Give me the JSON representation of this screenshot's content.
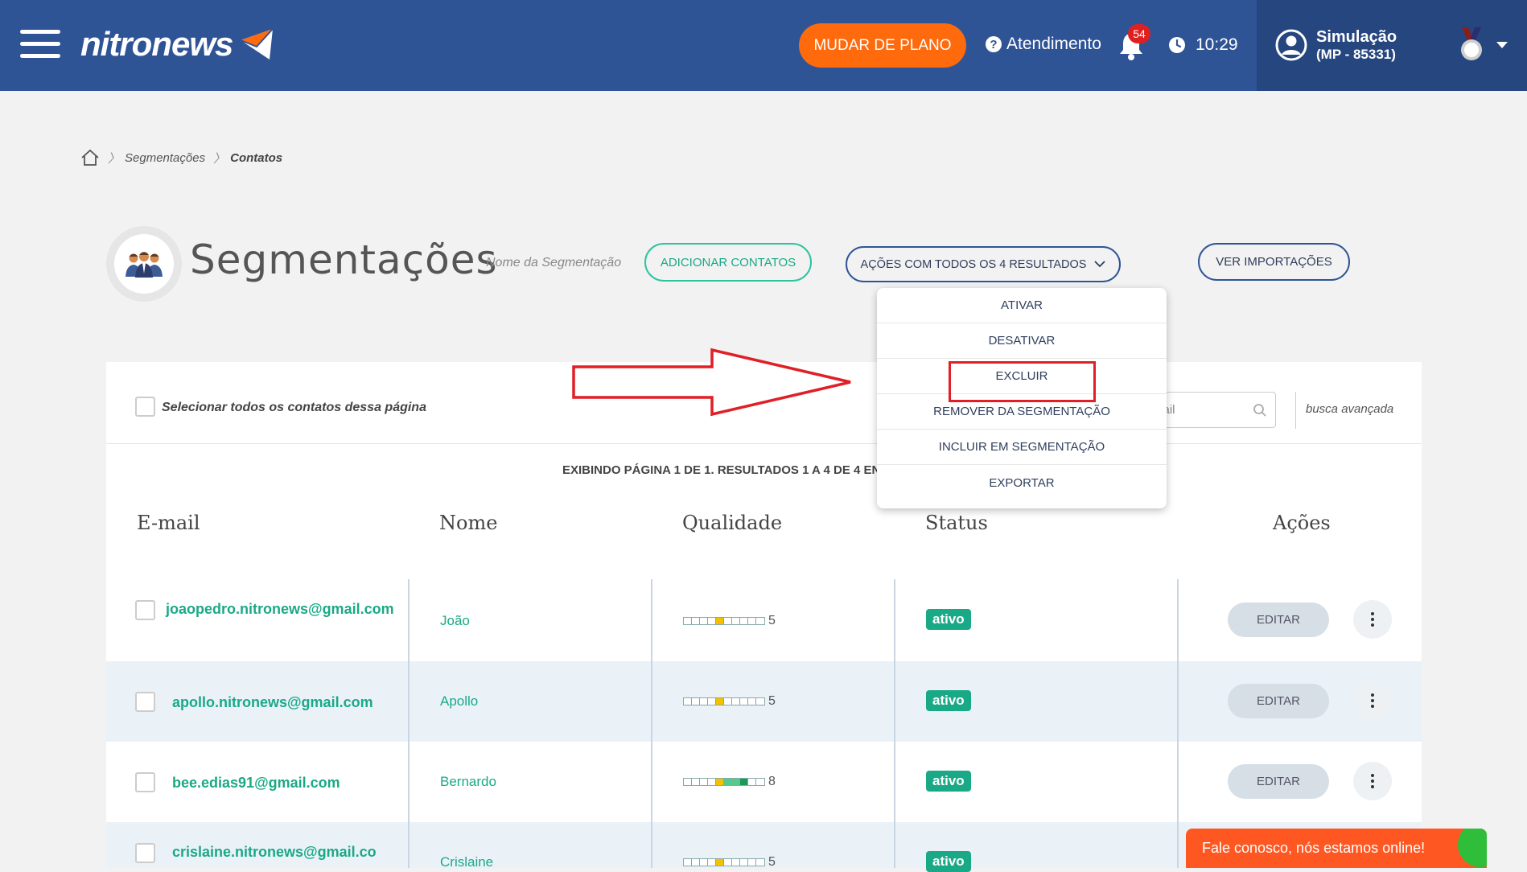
{
  "header": {
    "logo_text": "nitronews",
    "plan_button": "MUDAR DE PLANO",
    "support_label": "Atendimento",
    "notifications_count": "54",
    "time": "10:29",
    "user_name": "Simulação",
    "user_account": "(MP - 85331)"
  },
  "breadcrumb": {
    "items": [
      "Segmentações",
      "Contatos"
    ]
  },
  "page": {
    "title": "Segmentações",
    "segment_name_placeholder": "Nome da Segmentação",
    "add_contacts": "ADICIONAR CONTATOS",
    "bulk_actions": "AÇÕES COM TODOS OS 4 RESULTADOS",
    "view_imports": "VER IMPORTAÇÕES"
  },
  "dropdown": {
    "items": [
      "ATIVAR",
      "DESATIVAR",
      "EXCLUIR",
      "REMOVER DA SEGMENTAÇÃO",
      "INCLUIR EM SEGMENTAÇÃO",
      "EXPORTAR"
    ],
    "highlighted": "EXCLUIR"
  },
  "table": {
    "select_all_label": "Selecionar todos os contatos dessa página",
    "search_placeholder": "mail",
    "advanced_search": "busca avançada",
    "pager_text": "EXIBINDO PÁGINA 1 DE 1. RESULTADOS 1 A 4 DE 4 EN",
    "columns": [
      "E-mail",
      "Nome",
      "Qualidade",
      "Status",
      "Ações"
    ],
    "edit_label": "EDITAR",
    "rows": [
      {
        "email": "joaopedro.nitronews@gmail.com",
        "name": "João",
        "quality": "5",
        "status": "ativo"
      },
      {
        "email": "apollo.nitronews@gmail.com",
        "name": "Apollo",
        "quality": "5",
        "status": "ativo"
      },
      {
        "email": "bee.edias91@gmail.com",
        "name": "Bernardo",
        "quality": "8",
        "status": "ativo"
      },
      {
        "email": "crislaine.nitronews@gmail.co",
        "name": "Crislaine",
        "quality": "5",
        "status": "ativo"
      }
    ]
  },
  "chat": {
    "label": "Fale conosco, nós estamos online!"
  },
  "colors": {
    "header_bg": "#2f5496",
    "accent_orange": "#ff6a0c",
    "accent_green": "#1aa986",
    "highlight_red": "#e01f26"
  }
}
